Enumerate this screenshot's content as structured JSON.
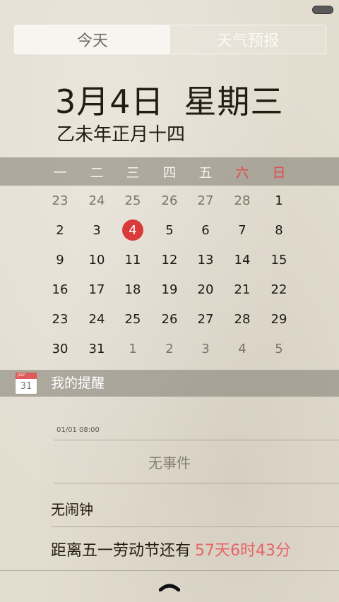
{
  "tabs": {
    "today": "今天",
    "weather": "天气预报"
  },
  "header": {
    "date": "3月4日",
    "weekday": "星期三",
    "lunar": "乙未年正月十四"
  },
  "weekdays": [
    "一",
    "二",
    "三",
    "四",
    "五",
    "六",
    "日"
  ],
  "calendar": {
    "rows": [
      [
        {
          "d": "23",
          "o": true
        },
        {
          "d": "24",
          "o": true
        },
        {
          "d": "25",
          "o": true
        },
        {
          "d": "26",
          "o": true
        },
        {
          "d": "27",
          "o": true
        },
        {
          "d": "28",
          "o": true
        },
        {
          "d": "1",
          "o": false
        }
      ],
      [
        {
          "d": "2",
          "o": false
        },
        {
          "d": "3",
          "o": false
        },
        {
          "d": "4",
          "o": false,
          "today": true
        },
        {
          "d": "5",
          "o": false
        },
        {
          "d": "6",
          "o": false
        },
        {
          "d": "7",
          "o": false
        },
        {
          "d": "8",
          "o": false
        }
      ],
      [
        {
          "d": "9",
          "o": false
        },
        {
          "d": "10",
          "o": false
        },
        {
          "d": "11",
          "o": false
        },
        {
          "d": "12",
          "o": false
        },
        {
          "d": "13",
          "o": false
        },
        {
          "d": "14",
          "o": false
        },
        {
          "d": "15",
          "o": false
        }
      ],
      [
        {
          "d": "16",
          "o": false
        },
        {
          "d": "17",
          "o": false
        },
        {
          "d": "18",
          "o": false
        },
        {
          "d": "19",
          "o": false
        },
        {
          "d": "20",
          "o": false
        },
        {
          "d": "21",
          "o": false
        },
        {
          "d": "22",
          "o": false
        }
      ],
      [
        {
          "d": "23",
          "o": false
        },
        {
          "d": "24",
          "o": false
        },
        {
          "d": "25",
          "o": false
        },
        {
          "d": "26",
          "o": false
        },
        {
          "d": "27",
          "o": false
        },
        {
          "d": "28",
          "o": false
        },
        {
          "d": "29",
          "o": false
        }
      ],
      [
        {
          "d": "30",
          "o": false
        },
        {
          "d": "31",
          "o": false
        },
        {
          "d": "1",
          "o": true
        },
        {
          "d": "2",
          "o": true
        },
        {
          "d": "3",
          "o": true
        },
        {
          "d": "4",
          "o": true
        },
        {
          "d": "5",
          "o": true
        }
      ]
    ]
  },
  "reminders": {
    "icon_month": "JULY",
    "icon_day": "31",
    "title": "我的提醒",
    "event_time": "01/01 08:00",
    "no_event": "无事件",
    "no_alarm": "无闹钟",
    "countdown_label": "距离五一劳动节还有",
    "countdown_value": "57天6时43分"
  },
  "colors": {
    "accent_red": "#d93a3a",
    "weekend_red": "#e04848",
    "countdown_red": "#e56464"
  },
  "icons": {
    "status": "battery-indicator-icon",
    "calendar": "calendar-icon",
    "handle": "chevron-up-icon"
  }
}
